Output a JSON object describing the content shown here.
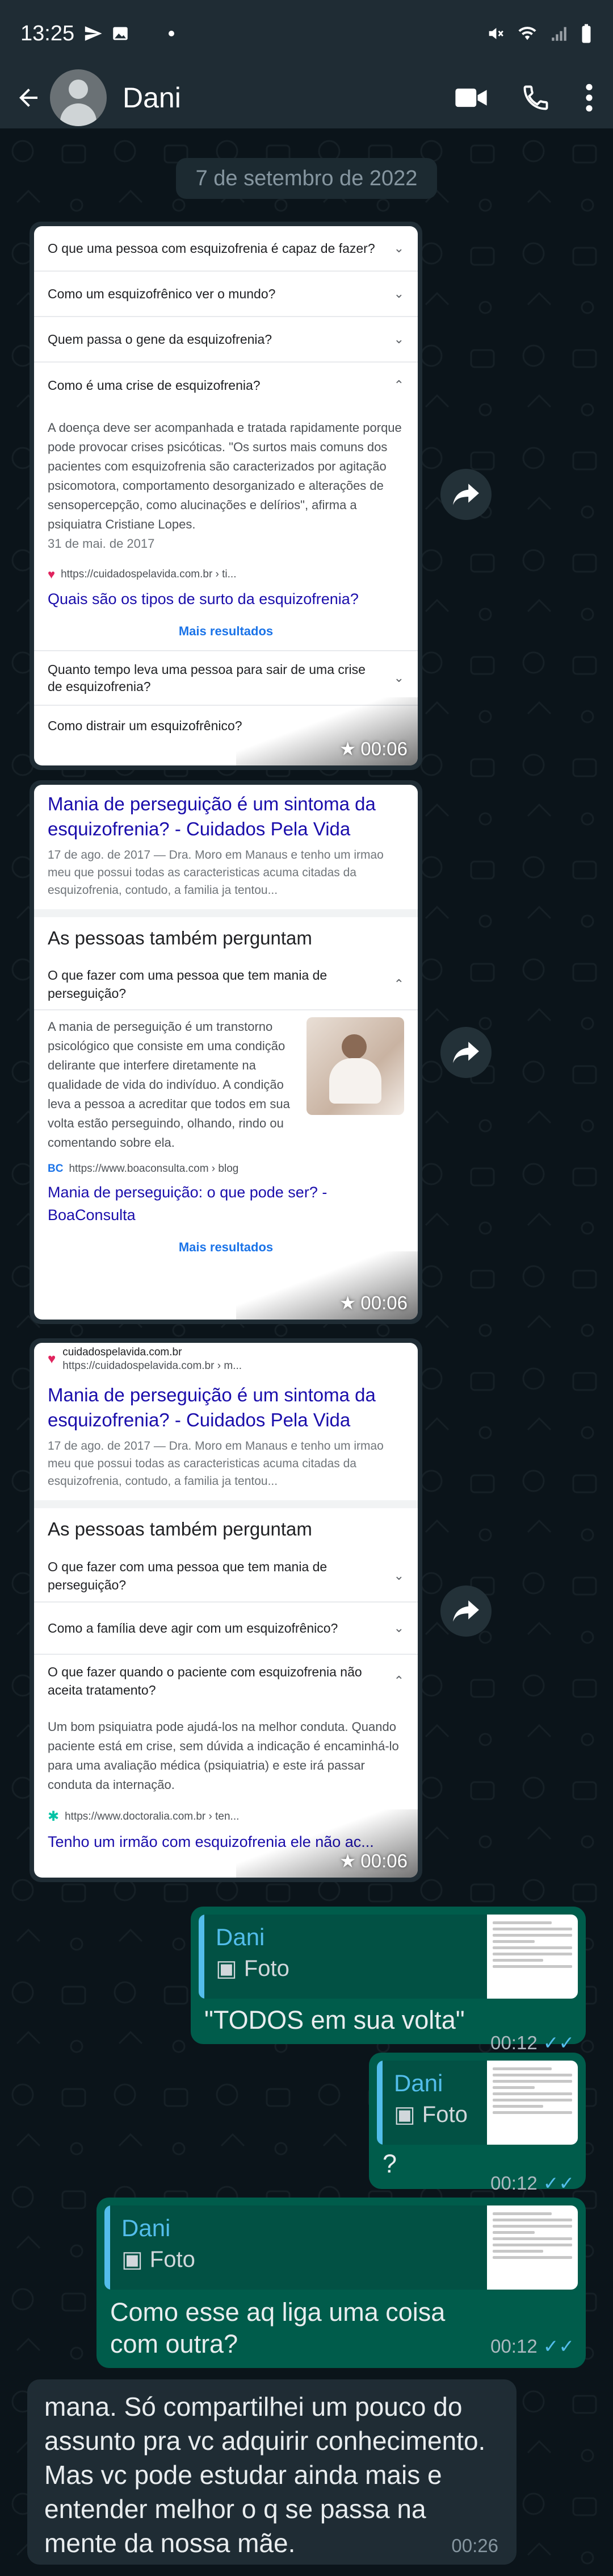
{
  "status_bar": {
    "time": "13:25",
    "left_icons": [
      "send-icon",
      "image-icon",
      "dot-icon"
    ],
    "right_icons": [
      "mute-icon",
      "wifi-icon",
      "signal-icon",
      "battery-icon"
    ]
  },
  "header": {
    "contact_name": "Dani",
    "actions": [
      "video-call-icon",
      "phone-icon",
      "more-options-icon"
    ]
  },
  "date_chip": "7 de setembro de 2022",
  "image_messages": [
    {
      "time": "00:06",
      "questions_top": [
        "O que uma pessoa com esquizofrenia é capaz de fazer?",
        "Como um esquizofrênico ver o mundo?",
        "Quem passa o gene da esquizofrenia?",
        "Como é uma crise de esquizofrenia?"
      ],
      "answer": "A doença deve ser acompanhada e tratada rapidamente porque pode provocar crises psicóticas. \"Os surtos mais comuns dos pacientes com esquizofrenia são caracterizados por agitação psicomotora, comportamento desorganizado e alterações de sensopercepção, como alucinações e delírios\", afirma a psiquiatra Cristiane Lopes.",
      "answer_date": "31 de mai. de 2017",
      "source_url": "https://cuidadospelavida.com.br › ti...",
      "link": "Quais são os tipos de surto da esquizofrenia?",
      "more": "Mais resultados",
      "questions_bottom": [
        "Quanto tempo leva uma pessoa para sair de uma crise de esquizofrenia?",
        "Como distrair um esquizofrênico?"
      ]
    },
    {
      "time": "00:06",
      "title": "Mania de perseguição é um sintoma da esquizofrenia? - Cuidados Pela Vida",
      "snippet": "17 de ago. de 2017 — Dra. Moro em Manaus e tenho um irmao meu que possui todas as caracteristicas acuma citadas da esquizofrenia, contudo, a familia ja tentou...",
      "section": "As pessoas também perguntam",
      "question": "O que fazer com uma pessoa que tem mania de perseguição?",
      "answer": "A mania de perseguição é um transtorno psicológico que consiste em uma condição delirante que interfere diretamente na qualidade de vida do indivíduo. A condição leva a pessoa a acreditar que todos em sua volta estão perseguindo, olhando, rindo ou comentando sobre ela.",
      "source_url": "https://www.boaconsulta.com › blog",
      "link": "Mania de perseguição: o que pode ser? - BoaConsulta",
      "more": "Mais resultados"
    },
    {
      "time": "00:06",
      "site": "cuidadospelavida.com.br",
      "site_url": "https://cuidadospelavida.com.br › m...",
      "title": "Mania de perseguição é um sintoma da esquizofrenia? - Cuidados Pela Vida",
      "snippet": "17 de ago. de 2017 — Dra. Moro em Manaus e tenho um irmao meu que possui todas as caracteristicas acuma citadas da esquizofrenia, contudo, a familia ja tentou...",
      "section": "As pessoas também perguntam",
      "questions": [
        "O que fazer com uma pessoa que tem mania de perseguição?",
        "Como a família deve agir com um esquizofrênico?",
        "O que fazer quando o paciente com esquizofrenia não aceita tratamento?"
      ],
      "answer": "Um bom psiquiatra pode ajudá-los na melhor conduta. Quando paciente está em crise, sem dúvida a indicação é encaminhá-lo para uma avaliação médica (psiquiatria) e este irá passar conduta da internação.",
      "source_url": "https://www.doctoralia.com.br › ten...",
      "link": "Tenho um irmão com esquizofrenia ele não ac..."
    }
  ],
  "outgoing": [
    {
      "quote_name": "Dani",
      "quote_label": "Foto",
      "text": "\"TODOS em sua volta\"",
      "time": "00:12"
    },
    {
      "quote_name": "Dani",
      "quote_label": "Foto",
      "text": "?",
      "time": "00:12"
    },
    {
      "quote_name": "Dani",
      "quote_label": "Foto",
      "text": "Como esse aq liga uma coisa com outra?",
      "time": "00:12"
    }
  ],
  "incoming": {
    "text": "mana. Só compartilhei um pouco do assunto pra vc adquirir conhecimento. Mas vc pode estudar ainda mais e entender melhor o q se passa na mente da nossa mãe.",
    "time": "00:26"
  }
}
